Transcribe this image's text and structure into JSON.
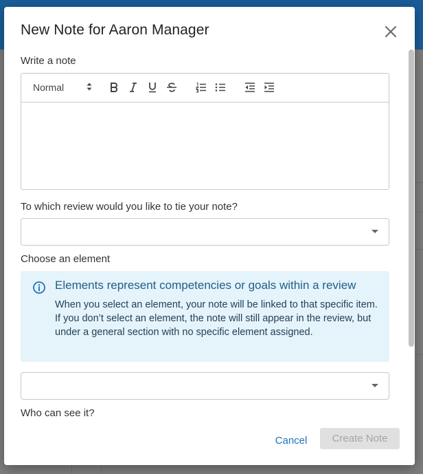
{
  "modal": {
    "title": "New Note for Aaron Manager",
    "close_icon": "close-icon"
  },
  "note_section": {
    "label": "Write a note",
    "toolbar": {
      "format_value": "Normal",
      "buttons": [
        "bold-icon",
        "italic-icon",
        "underline-icon",
        "strikethrough-icon",
        "ordered-list-icon",
        "bullet-list-icon",
        "outdent-icon",
        "indent-icon"
      ]
    },
    "body_text": ""
  },
  "review_section": {
    "label": "To which review would you like to tie your note?",
    "selected_value": ""
  },
  "element_section": {
    "label": "Choose an element",
    "info_icon": "info-icon",
    "info_title": "Elements represent competencies or goals within a review",
    "info_text": "When you select an element, your note will be linked to that specific item. If you don’t select an element, the note will still appear in the review, but under a general section with no specific element assigned.",
    "selected_value": ""
  },
  "visibility_section": {
    "label": "Who can see it?"
  },
  "footer": {
    "cancel_label": "Cancel",
    "create_label": "Create Note"
  },
  "colors": {
    "accent": "#1f73b7",
    "info_background": "#e5f3fa",
    "info_title": "#1d5f8a",
    "disabled_button": "#e0e0e0"
  }
}
